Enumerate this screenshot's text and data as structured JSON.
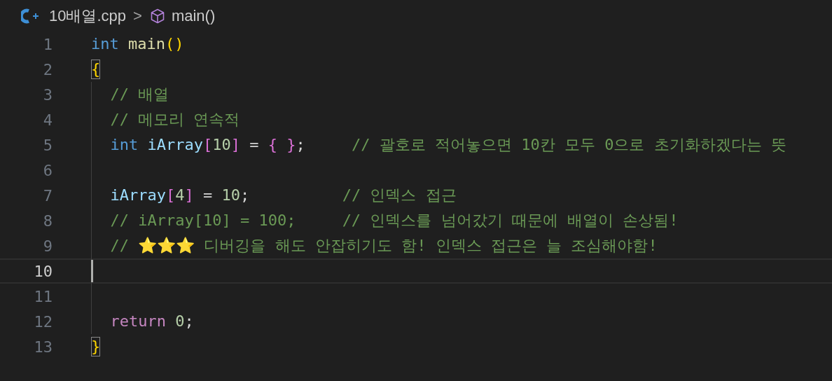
{
  "breadcrumb": {
    "file": "10배열.cpp",
    "separator": ">",
    "symbol": "main()"
  },
  "lines": [
    {
      "number": "1",
      "indented": false,
      "current": false,
      "tokens": [
        {
          "kind": "keyword",
          "text": "int "
        },
        {
          "kind": "function",
          "text": "main"
        },
        {
          "kind": "paren",
          "text": "()"
        }
      ]
    },
    {
      "number": "2",
      "indented": false,
      "current": false,
      "tokens": [
        {
          "kind": "paren",
          "text": "{",
          "matched": true
        }
      ]
    },
    {
      "number": "3",
      "indented": true,
      "current": false,
      "tokens": [
        {
          "kind": "comment",
          "text": "// 배열"
        }
      ]
    },
    {
      "number": "4",
      "indented": true,
      "current": false,
      "tokens": [
        {
          "kind": "comment",
          "text": "// 메모리 연속적"
        }
      ]
    },
    {
      "number": "5",
      "indented": true,
      "current": false,
      "tokens": [
        {
          "kind": "keyword",
          "text": "int "
        },
        {
          "kind": "variable",
          "text": "iArray"
        },
        {
          "kind": "bracket",
          "text": "["
        },
        {
          "kind": "number",
          "text": "10"
        },
        {
          "kind": "bracket",
          "text": "]"
        },
        {
          "kind": "operator",
          "text": " = "
        },
        {
          "kind": "bracket",
          "text": "{ }"
        },
        {
          "kind": "operator",
          "text": ";     "
        },
        {
          "kind": "comment",
          "text": "// 괄호로 적어놓으면 10칸 모두 0으로 초기화하겠다는 뜻"
        }
      ]
    },
    {
      "number": "6",
      "indented": true,
      "current": false
    },
    {
      "number": "7",
      "indented": true,
      "current": false,
      "tokens": [
        {
          "kind": "variable",
          "text": "iArray"
        },
        {
          "kind": "bracket",
          "text": "["
        },
        {
          "kind": "number",
          "text": "4"
        },
        {
          "kind": "bracket",
          "text": "]"
        },
        {
          "kind": "operator",
          "text": " = "
        },
        {
          "kind": "number",
          "text": "10"
        },
        {
          "kind": "operator",
          "text": ";          "
        },
        {
          "kind": "comment",
          "text": "// 인덱스 접근"
        }
      ]
    },
    {
      "number": "8",
      "indented": true,
      "current": false,
      "tokens": [
        {
          "kind": "comment",
          "text": "// iArray[10] = 100;     // 인덱스를 넘어갔기 때문에 배열이 손상됨!"
        }
      ]
    },
    {
      "number": "9",
      "indented": true,
      "current": false,
      "tokens": [
        {
          "kind": "comment",
          "text": "// ⭐⭐⭐ 디버깅을 해도 안잡히기도 함! 인덱스 접근은 늘 조심해야함!"
        }
      ]
    },
    {
      "number": "10",
      "indented": true,
      "current": true
    },
    {
      "number": "11",
      "indented": true,
      "current": false
    },
    {
      "number": "12",
      "indented": true,
      "current": false,
      "tokens": [
        {
          "kind": "control",
          "text": "return "
        },
        {
          "kind": "number",
          "text": "0"
        },
        {
          "kind": "operator",
          "text": ";"
        }
      ]
    },
    {
      "number": "13",
      "indented": false,
      "current": false,
      "tokens": [
        {
          "kind": "paren",
          "text": "}",
          "matched": true
        }
      ]
    }
  ]
}
